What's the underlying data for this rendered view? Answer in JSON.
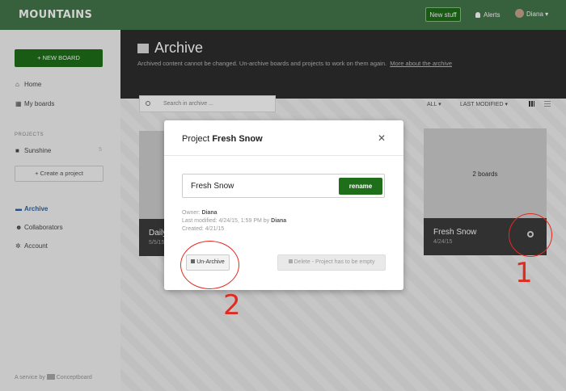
{
  "app": {
    "logo": "MOUNTAINS",
    "new_stuff": "New stuff",
    "alerts": "Alerts",
    "user": "Diana"
  },
  "sidebar": {
    "new_board": "+ NEW BOARD",
    "nav": [
      {
        "label": "Home",
        "icon": "home-icon"
      },
      {
        "label": "My boards",
        "icon": "grid-icon"
      }
    ],
    "projects_heading": "PROJECTS",
    "project": {
      "label": "Sunshine",
      "count": "5",
      "icon": "folder-icon"
    },
    "create_project": "+ Create a project",
    "nav2": [
      {
        "label": "Archive",
        "icon": "archive-icon"
      },
      {
        "label": "Collaborators",
        "icon": "people-icon"
      },
      {
        "label": "Account",
        "icon": "gear-icon"
      }
    ],
    "footer_prefix": "A service by",
    "footer_brand": "Conceptboard"
  },
  "header": {
    "title": "Archive",
    "subtitle": "Archived content cannot be changed. Un-archive boards and projects to work on them again.",
    "link": "More about the archive"
  },
  "toolbar": {
    "search_placeholder": "Search in archive ...",
    "filter_all": "ALL ▾",
    "sort": "LAST MODIFIED ▾"
  },
  "cards": [
    {
      "name": "Daily",
      "date": "5/5/15"
    },
    {
      "name": "Fresh Snow",
      "date": "4/24/15",
      "boards": "2 boards"
    }
  ],
  "modal": {
    "title_prefix": "Project",
    "title_name": "Fresh Snow",
    "name_value": "Fresh Snow",
    "rename": "rename",
    "owner_label": "Owner:",
    "owner": "Diana",
    "modified_label": "Last modified: 4/24/15, 1:59 PM by",
    "modified_by": "Diana",
    "created_label": "Created: 4/21/15",
    "unarchive": "Un-Archive",
    "delete": "Delete - Project has to be empty"
  },
  "annotations": {
    "one": "1",
    "two": "2"
  },
  "colors": {
    "brand_green": "#44764a",
    "button_green": "#1f6e1a",
    "annotation_red": "#e02b20",
    "active_link": "#2f64a0"
  }
}
